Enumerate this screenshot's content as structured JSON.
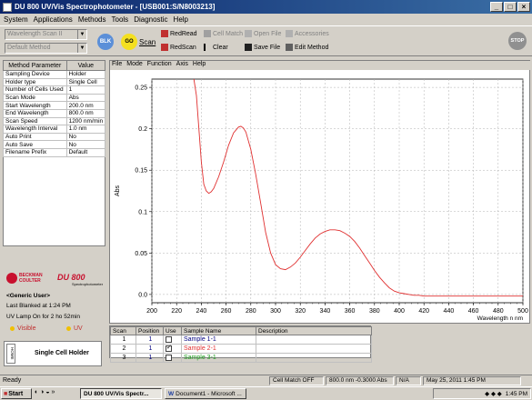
{
  "window": {
    "title": "DU 800 UV/Vis Spectrophotometer - [USB001:S/N8003213]"
  },
  "menubar": [
    "System",
    "Applications",
    "Methods",
    "Tools",
    "Diagnostic",
    "Help"
  ],
  "toolbar": {
    "method_combo": "Wavelength Scan II",
    "default_combo": "Default Method",
    "blk_label": "BLK",
    "go_label": "GO",
    "scan_label": "Scan",
    "redread_label": "RedRead",
    "redscan_label": "RedScan",
    "cell_match_label": "Cell Match",
    "clear_label": "Clear",
    "open_file_label": "Open File",
    "save_file_label": "Save File",
    "accessories_label": "Accessories",
    "edit_method_label": "Edit Method",
    "stop_label": "STOP"
  },
  "params": {
    "header_param": "Method Parameter",
    "header_value": "Value",
    "rows": [
      {
        "name": "Sampling Device",
        "value": "Holder"
      },
      {
        "name": "Holder type",
        "value": "Single Cell"
      },
      {
        "name": "Number of Cells Used",
        "value": "1"
      },
      {
        "name": "Scan Mode",
        "value": "Abs"
      },
      {
        "name": "Start Wavelength",
        "value": "200.0 nm"
      },
      {
        "name": "End Wavelength",
        "value": "800.0 nm"
      },
      {
        "name": "Scan Speed",
        "value": "1200 nm/min"
      },
      {
        "name": "Wavelength Interval",
        "value": "1.0 nm"
      },
      {
        "name": "Auto Print",
        "value": "No"
      },
      {
        "name": "Auto Save",
        "value": "No"
      },
      {
        "name": "Filename Prefix",
        "value": "Default"
      }
    ]
  },
  "brand": {
    "beckman_line1": "BECKMAN",
    "beckman_line2": "COULTER",
    "model": "DU 800",
    "model_sub": "Spectrophotometer",
    "user": "<Generic User>",
    "last_blanked": "Last Blanked at 1:24 PM",
    "lamp_on": "UV Lamp On for 2 ho 52min",
    "visible_label": "Visible",
    "uv_label": "UV",
    "holder_side": "HOME",
    "holder_label": "Single Cell Holder"
  },
  "chart_menu": [
    "File",
    "Mode",
    "Function",
    "Axis",
    "Help"
  ],
  "chart_data": {
    "type": "line",
    "xlabel": "Wavelength n nm",
    "ylabel": "Abs",
    "xlim": [
      200,
      500
    ],
    "ylim": [
      -0.01,
      0.26
    ],
    "xticks": [
      200,
      220,
      240,
      260,
      280,
      300,
      320,
      340,
      360,
      380,
      400,
      420,
      440,
      460,
      480,
      500
    ],
    "yticks": [
      0.0,
      0.05,
      0.1,
      0.15,
      0.2,
      0.25
    ],
    "ytick_labels": [
      "0.0",
      "0.05",
      "0.1",
      "0.15",
      "0.2",
      "0.25"
    ],
    "grid": true,
    "series": [
      {
        "color": "#e03030",
        "x": [
          234,
          236,
          238,
          240,
          242,
          244,
          246,
          248,
          250,
          254,
          258,
          262,
          266,
          270,
          272,
          274,
          276,
          280,
          284,
          288,
          292,
          296,
          300,
          304,
          308,
          312,
          316,
          320,
          324,
          328,
          332,
          336,
          340,
          344,
          348,
          352,
          356,
          360,
          364,
          368,
          372,
          376,
          380,
          384,
          388,
          392,
          396,
          400,
          404,
          408,
          412,
          416,
          420,
          430,
          440,
          460,
          480,
          500
        ],
        "y": [
          0.26,
          0.24,
          0.2,
          0.16,
          0.133,
          0.125,
          0.122,
          0.124,
          0.128,
          0.142,
          0.16,
          0.18,
          0.195,
          0.202,
          0.203,
          0.201,
          0.196,
          0.175,
          0.145,
          0.11,
          0.075,
          0.05,
          0.036,
          0.031,
          0.03,
          0.033,
          0.038,
          0.045,
          0.053,
          0.061,
          0.068,
          0.073,
          0.076,
          0.078,
          0.078,
          0.077,
          0.074,
          0.07,
          0.064,
          0.056,
          0.047,
          0.038,
          0.029,
          0.021,
          0.014,
          0.008,
          0.004,
          0.002,
          0.001,
          0.0,
          -0.001,
          -0.001,
          -0.002,
          -0.002,
          -0.002,
          -0.002,
          -0.002,
          -0.002
        ]
      }
    ]
  },
  "samples": {
    "headers": [
      "Scan",
      "Position",
      "Use",
      "Sample Name",
      "Description"
    ],
    "rows": [
      {
        "scan": "1",
        "position": "1",
        "use": false,
        "name": "Sample 1-1",
        "color": "#000080"
      },
      {
        "scan": "2",
        "position": "1",
        "use": true,
        "name": "Sample 2-1",
        "color": "#e03030"
      },
      {
        "scan": "3",
        "position": "1",
        "use": false,
        "name": "Sample 3-1",
        "color": "#20a020"
      }
    ]
  },
  "status": {
    "ready": "Ready",
    "cell_match": "Cell Match OFF",
    "reading": "800.0 nm -0.3000 Abs",
    "na": "N/A",
    "datetime": "May 25, 2011 1:45 PM"
  },
  "taskbar": {
    "start": "Start",
    "task1": "DU 800 UV/Vis Spectr...",
    "task2": "Document1 - Microsoft ...",
    "clock": "1:45 PM"
  }
}
